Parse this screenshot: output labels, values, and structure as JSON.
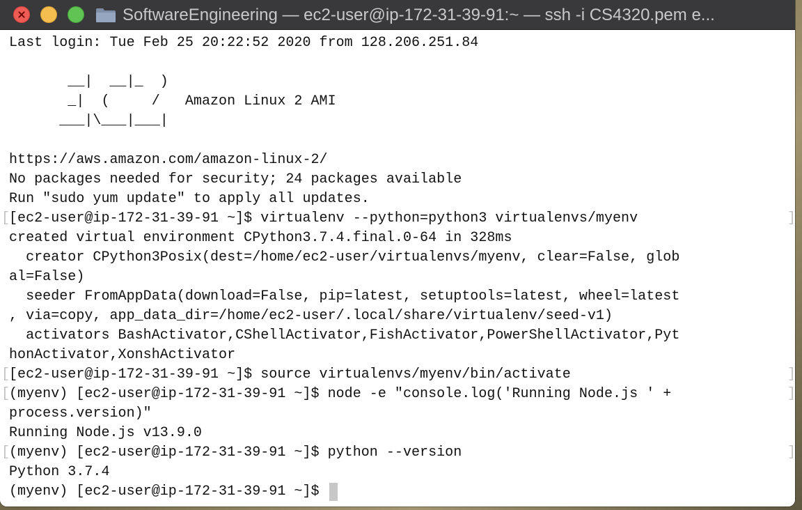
{
  "window": {
    "title": "SoftwareEngineering — ec2-user@ip-172-31-39-91:~ — ssh -i CS4320.pem e..."
  },
  "icons": {
    "close": "close-icon",
    "minimize": "minimize-icon",
    "maximize": "maximize-icon",
    "folder": "folder-icon"
  },
  "colors": {
    "titlebar": "#39393b",
    "close": "#ee5c56",
    "minimize": "#f5bd4f",
    "maximize": "#5fc453",
    "text": "#111111",
    "background": "#ffffff",
    "cursor": "#c7c7c7"
  },
  "terminal": {
    "lines": [
      "Last login: Tue Feb 25 20:22:52 2020 from 128.206.251.84",
      "",
      "       __|  __|_  )",
      "       _|  (     /   Amazon Linux 2 AMI",
      "      ___|\\___|___|",
      "",
      "https://aws.amazon.com/amazon-linux-2/",
      "No packages needed for security; 24 packages available",
      "Run \"sudo yum update\" to apply all updates.",
      "[ec2-user@ip-172-31-39-91 ~]$ virtualenv --python=python3 virtualenvs/myenv",
      "created virtual environment CPython3.7.4.final.0-64 in 328ms",
      "  creator CPython3Posix(dest=/home/ec2-user/virtualenvs/myenv, clear=False, glob",
      "al=False)",
      "  seeder FromAppData(download=False, pip=latest, setuptools=latest, wheel=latest",
      ", via=copy, app_data_dir=/home/ec2-user/.local/share/virtualenv/seed-v1)",
      "  activators BashActivator,CShellActivator,FishActivator,PowerShellActivator,Pyt",
      "honActivator,XonshActivator",
      "[ec2-user@ip-172-31-39-91 ~]$ source virtualenvs/myenv/bin/activate",
      "(myenv) [ec2-user@ip-172-31-39-91 ~]$ node -e \"console.log('Running Node.js ' +",
      "process.version)\"",
      "Running Node.js v13.9.0",
      "(myenv) [ec2-user@ip-172-31-39-91 ~]$ python --version",
      "Python 3.7.4",
      "(myenv) [ec2-user@ip-172-31-39-91 ~]$ "
    ]
  }
}
